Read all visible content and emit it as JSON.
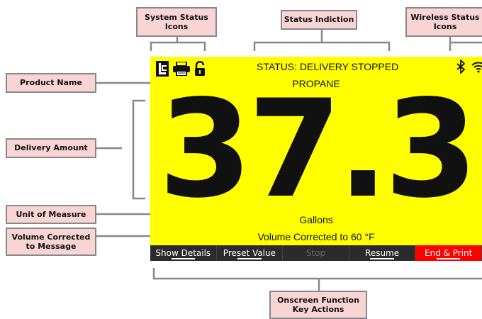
{
  "callouts": {
    "system_status": "System Status\nIcons",
    "status_indication": "Status Indiction",
    "wireless_status": "Wireless Status\nIcons",
    "product_name": "Product Name",
    "delivery_amount": "Delivery Amount",
    "unit_of_measure": "Unit of Measure",
    "volume_corrected": "Volume Corrected\nto Message",
    "function_keys": "Onscreen Function\nKey Actions"
  },
  "screen": {
    "status": "STATUS: DELIVERY STOPPED",
    "product": "PROPANE",
    "amount": "37.3",
    "unit": "Gallons",
    "volume_corrected": "Volume Corrected to 60 °F",
    "function_keys": [
      "Show Details",
      "Preset Value",
      "Stop",
      "Resume",
      "End & Print"
    ],
    "icons": [
      "lc-logo-icon",
      "printer-icon",
      "unlock-icon",
      "bluetooth-icon",
      "wifi-icon"
    ],
    "colors": {
      "background": "#ffff00",
      "end_key": "#ff0000",
      "key_bar": "#2b2b2b"
    }
  }
}
